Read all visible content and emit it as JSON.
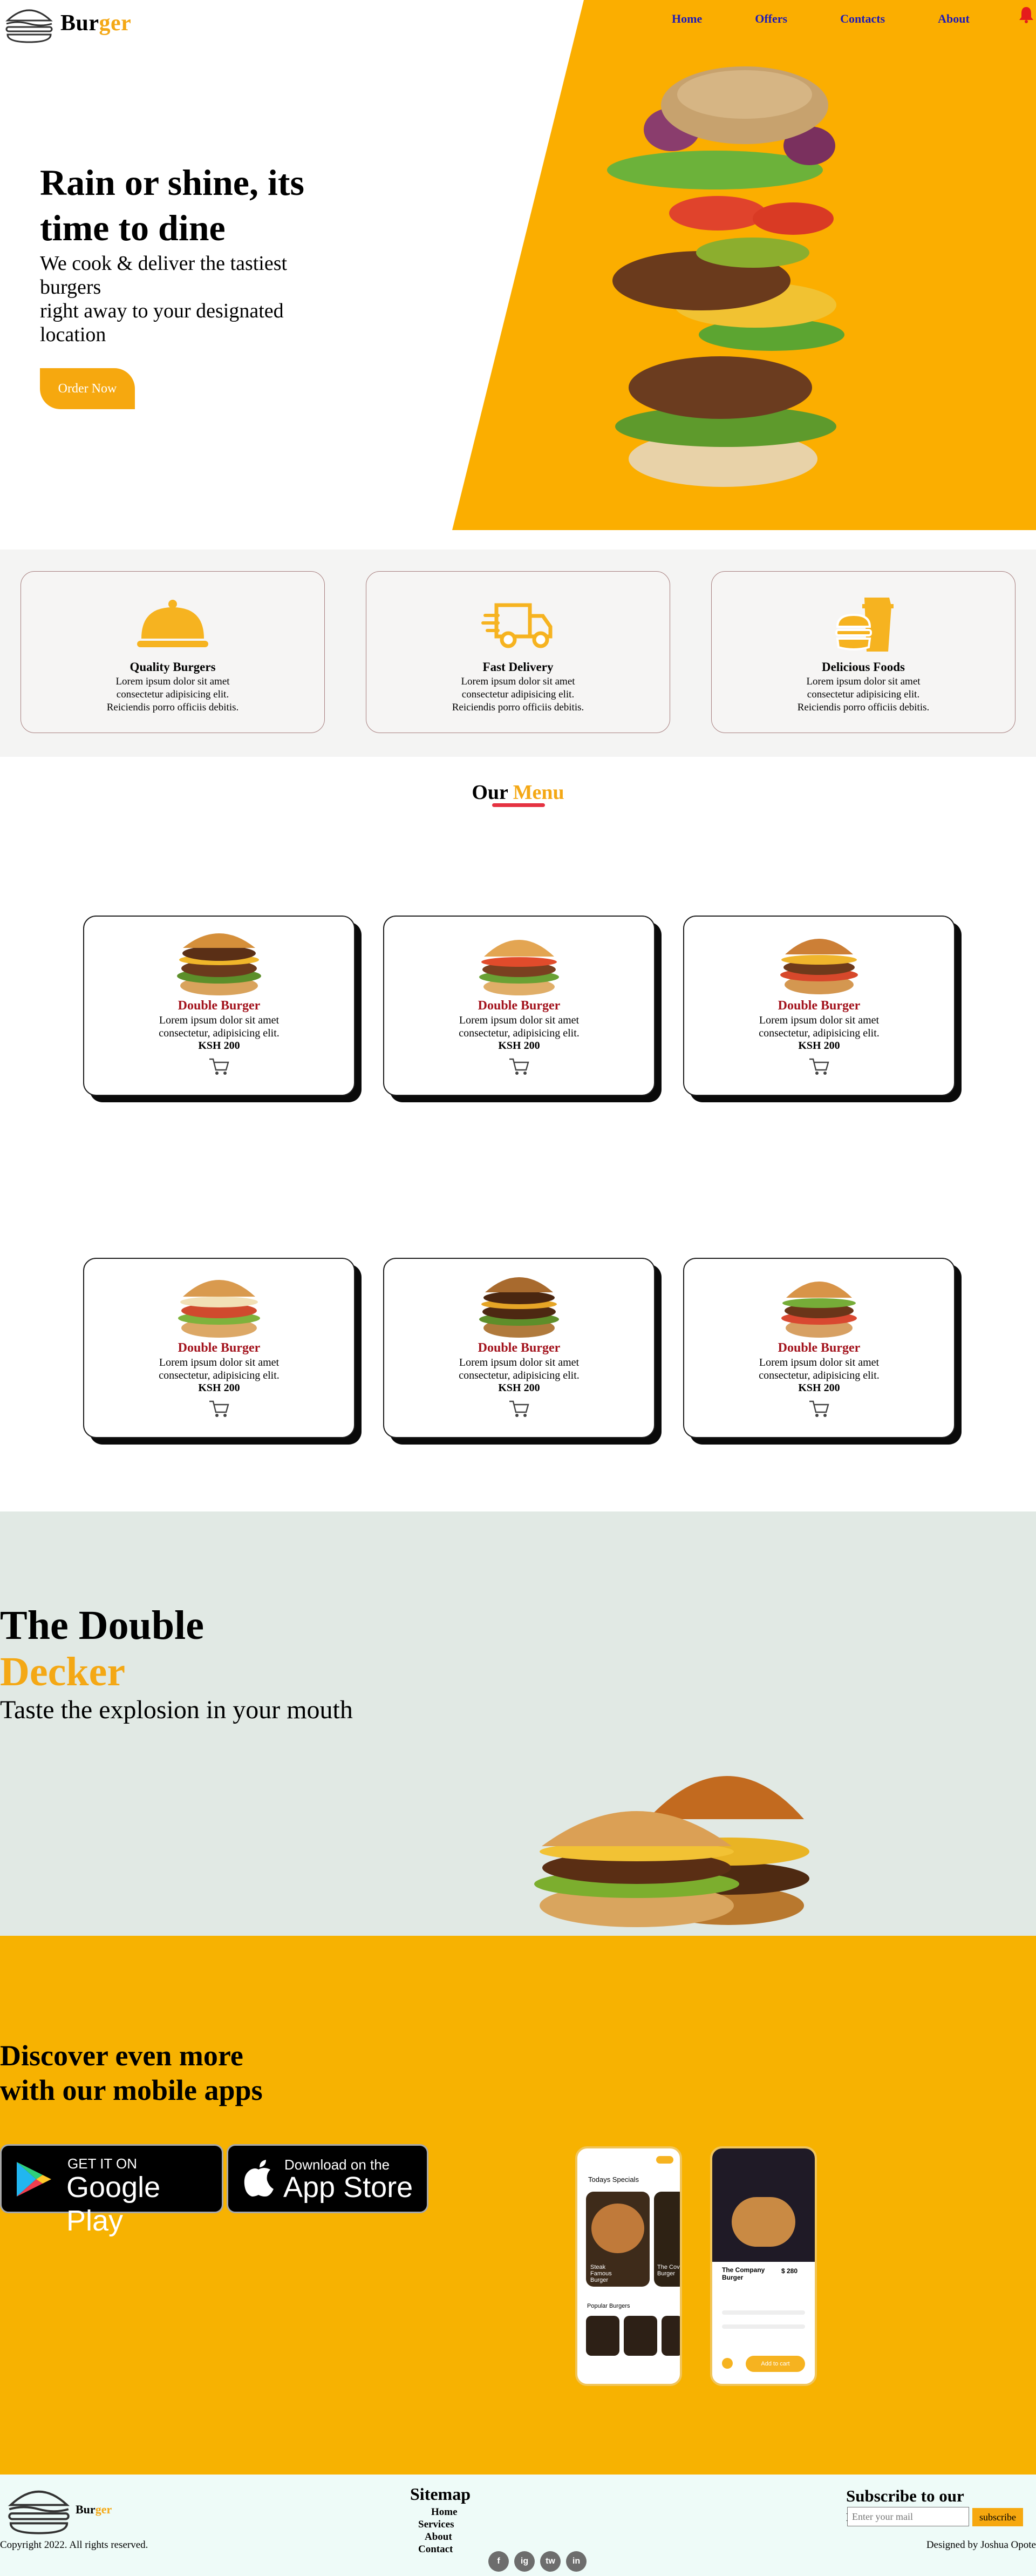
{
  "colors": {
    "accent": "#f4a815",
    "hero_orange": "#fbae00",
    "brand_red": "#a3131d",
    "underline_red": "#e53241",
    "nav_link": "#1e1bb8",
    "dd_bg": "#e1e9e4",
    "apps_bg": "#f7b201"
  },
  "brand": {
    "part1": "Bur",
    "part2": "ger"
  },
  "nav": {
    "links": [
      "Home",
      "Offers",
      "Contacts",
      "About"
    ],
    "bell_icon": "bell-icon"
  },
  "hero": {
    "title": "Rain or shine, its time to dine",
    "subtitle_line1": "We cook & deliver the tastiest burgers",
    "subtitle_line2": "right away to your designated location",
    "cta": "Order Now"
  },
  "features": [
    {
      "icon": "cloche-icon",
      "title": "Quality Burgers",
      "line1": "Lorem ipsum dolor sit amet",
      "line2": "consectetur adipisicing elit.",
      "line3": "Reiciendis porro officiis debitis."
    },
    {
      "icon": "delivery-truck-icon",
      "title": "Fast Delivery",
      "line1": "Lorem ipsum dolor sit amet",
      "line2": "consectetur adipisicing elit.",
      "line3": "Reiciendis porro officiis debitis."
    },
    {
      "icon": "burger-drink-icon",
      "title": "Delicious Foods",
      "line1": "Lorem ipsum dolor sit amet",
      "line2": "consectetur adipisicing elit.",
      "line3": "Reiciendis porro officiis debitis."
    }
  ],
  "menu": {
    "heading_part1": "Our",
    "heading_part2": "Menu",
    "items": [
      {
        "name": "Double Burger",
        "line1": "Lorem ipsum dolor sit amet",
        "line2": "consectetur, adipisicing elit.",
        "price": "KSH 200"
      },
      {
        "name": "Double Burger",
        "line1": "Lorem ipsum dolor sit amet",
        "line2": "consectetur, adipisicing elit.",
        "price": "KSH 200"
      },
      {
        "name": "Double Burger",
        "line1": "Lorem ipsum dolor sit amet",
        "line2": "consectetur, adipisicing elit.",
        "price": "KSH 200"
      },
      {
        "name": "Double Burger",
        "line1": "Lorem ipsum dolor sit amet",
        "line2": "consectetur, adipisicing elit.",
        "price": "KSH 200"
      },
      {
        "name": "Double Burger",
        "line1": "Lorem ipsum dolor sit amet",
        "line2": "consectetur, adipisicing elit.",
        "price": "KSH 200"
      },
      {
        "name": "Double Burger",
        "line1": "Lorem ipsum dolor sit amet",
        "line2": "consectetur, adipisicing elit.",
        "price": "KSH 200"
      }
    ]
  },
  "double_decker": {
    "title_line1": "The Double",
    "title_line2": "Decker",
    "subtitle": "Taste the explosion in your mouth"
  },
  "apps": {
    "title": "Discover even more with our mobile apps",
    "google_small": "GET IT ON",
    "google_big": "Google Play",
    "apple_small": "Download on the",
    "apple_big": "App Store",
    "phone1": {
      "header": "Todays Specials",
      "card1": "Steak Famous Burger",
      "card2": "The Cove Burger",
      "section": "Popular Burgers"
    },
    "phone2": {
      "name": "The Company Burger",
      "price": "$ 280",
      "cta": "Add to cart"
    }
  },
  "footer": {
    "brand_part1": "Bur",
    "brand_part2": "ger",
    "sitemap_title": "Sitemap",
    "sitemap_links": [
      "Home",
      "Services",
      "About",
      "Contact"
    ],
    "newsletter_title": "Subscribe to our newsletter",
    "newsletter_placeholder": "Enter your mail",
    "subscribe": "subscribe",
    "copyright": "Copyright 2022. All rights reserved.",
    "designed_by": "Designed by Joshua Opote",
    "socials": [
      "f",
      "ig",
      "tw",
      "in"
    ]
  }
}
